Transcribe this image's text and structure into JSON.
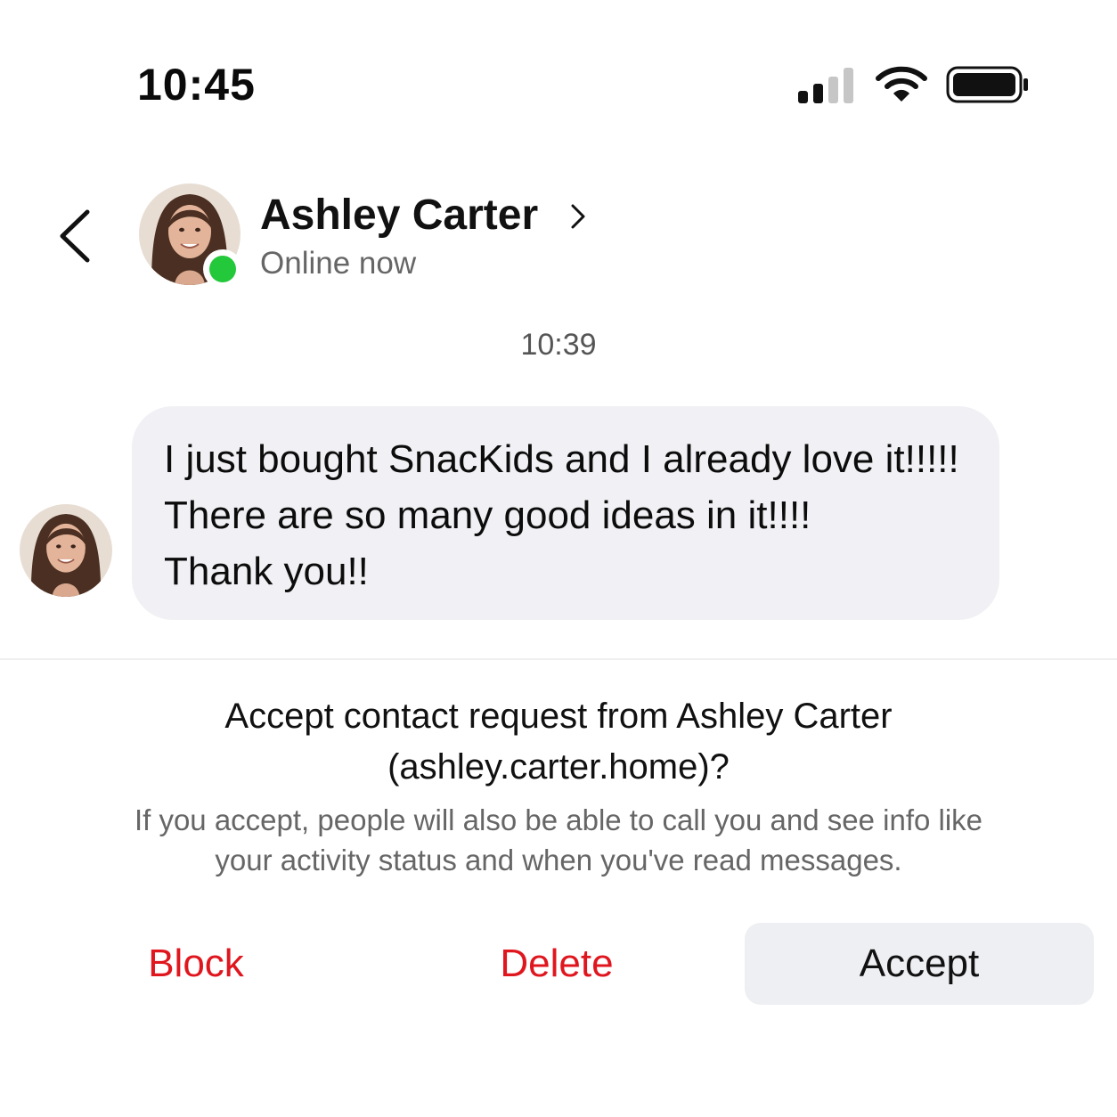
{
  "status_bar": {
    "time": "10:45",
    "signal_icon": "cellular-signal-icon",
    "wifi_icon": "wifi-icon",
    "battery_icon": "battery-icon",
    "signal_bars_active": 2,
    "signal_bars_total": 4
  },
  "header": {
    "back_icon": "chevron-left-icon",
    "contact_name": "Ashley Carter",
    "name_chevron_icon": "chevron-right-icon",
    "presence_text": "Online now",
    "presence_color": "#23c93a"
  },
  "conversation": {
    "timestamp": "10:39",
    "messages": [
      {
        "lines": [
          "I just bought SnacKids and I already love it!!!!!",
          "There are so many good ideas in it!!!!",
          "Thank you!!"
        ]
      }
    ]
  },
  "request": {
    "title_lines": [
      "Accept contact request from Ashley Carter",
      "(ashley.carter.home)?"
    ],
    "description_lines": [
      "If you accept, people will also be able to call you and see info like",
      "your activity status and when you've read messages."
    ]
  },
  "actions": {
    "block_label": "Block",
    "delete_label": "Delete",
    "accept_label": "Accept",
    "destructive_color": "#e0161e"
  }
}
